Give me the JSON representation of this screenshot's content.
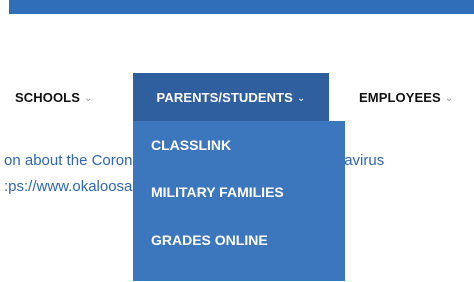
{
  "nav": {
    "items": [
      {
        "label": "SCHOOLS",
        "chevron": "⌄"
      },
      {
        "label": "PARENTS/STUDENTS",
        "chevron": "⌄"
      },
      {
        "label": "EMPLOYEES",
        "chevron": "⌄"
      }
    ]
  },
  "dropdown": {
    "items": [
      {
        "label": "CLASSLINK"
      },
      {
        "label": "MILITARY FAMILIES"
      },
      {
        "label": "GRADES ONLINE"
      }
    ]
  },
  "content": {
    "line1": "on about the Coronavirus be sure to visit our Coronavirus",
    "line2": ":ps://www.okaloosaschools.net/okcdct/coronavirus."
  },
  "colors": {
    "top_bar": "#2e6fb7",
    "nav_active_bg": "#2f5f9e",
    "dropdown_bg": "#3c76bd",
    "link_text": "#2f67b3"
  }
}
